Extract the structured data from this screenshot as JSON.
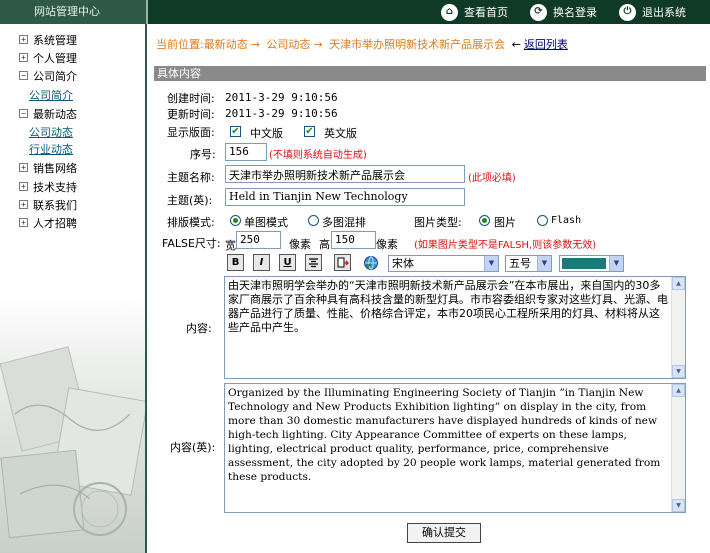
{
  "header": {
    "logo": "网站管理中心",
    "links": [
      {
        "label": "查看首页",
        "icon": "home-icon"
      },
      {
        "label": "换名登录",
        "icon": "switch-user-icon"
      },
      {
        "label": "退出系统",
        "icon": "logout-icon"
      }
    ]
  },
  "sidebar": {
    "items": [
      {
        "label": "系统管理",
        "toggle": "+"
      },
      {
        "label": "个人管理",
        "toggle": "+"
      },
      {
        "label": "公司简介",
        "toggle": "−"
      },
      {
        "label": "最新动态",
        "toggle": "−"
      },
      {
        "label": "销售网络",
        "toggle": "+"
      },
      {
        "label": "技术支持",
        "toggle": "+"
      },
      {
        "label": "联系我们",
        "toggle": "+"
      },
      {
        "label": "人才招聘",
        "toggle": "+"
      }
    ],
    "subitems": {
      "company_intro": "公司简介",
      "company_news": "公司动态",
      "industry_news": "行业动态"
    }
  },
  "breadcrumb": {
    "prefix": "当前位置:最新动态",
    "arrow": "→",
    "level2": "公司动态",
    "level3": "天津市举办照明新技术新产品展示会",
    "back_arrow": "←",
    "back_label": "返回列表"
  },
  "section_title": "具体内容",
  "form": {
    "created_label": "创建时间:",
    "created_value": "2011-3-29 9:10:56",
    "updated_label": "更新时间:",
    "updated_value": "2011-3-29 9:10:56",
    "display_label": "显示版面:",
    "chinese_label": "中文版",
    "english_label": "英文版",
    "seq_label": "序号:",
    "seq_value": "156",
    "seq_hint": "(不填则系统自动生成)",
    "title_label": "主题名称:",
    "title_value": "天津市举办照明新技术新产品展示会",
    "title_hint": "(此项必填)",
    "title_en_label": "主题(英):",
    "title_en_value": "Held in Tianjin New Technology",
    "layout_label": "排版模式:",
    "layout_single": "单图模式",
    "layout_multi": "多图混排",
    "pic_type_label": "图片类型:",
    "pic_type_image": "图片",
    "pic_type_flash": "Flash",
    "size_label": "FALSE尺寸:",
    "width_label": "宽",
    "width_value": "250",
    "px_label": "像素",
    "height_label": "高",
    "height_value": "150",
    "px_label2": "像素",
    "size_hint": "(如果图片类型不是FALSH,则该参数无效)",
    "font_select": "宋体",
    "size_select": "五号",
    "color_value": "#1a7a7a",
    "content_label": "内容:",
    "content_value": "由天津市照明学会举办的“天津市照明新技术新产品展示会”在本市展出，来自国内的30多家厂商展示了百余种具有高科技含量的新型灯具。市市容委组织专家对这些灯具、光源、电器产品进行了质量、性能、价格综合评定，本市20项民心工程所采用的灯具、材料将从这些产品中产生。",
    "content_en_label": "内容(英):",
    "content_en_value": "Organized by the Illuminating Engineering Society of Tianjin ”in Tianjin New Technology and New Products Exhibition lighting” on display in the city, from more than 30 domestic manufacturers have displayed hundreds of kinds of new high-tech lighting. City Appearance Committee of experts on these lamps, lighting, electrical product quality, performance, price, comprehensive assessment, the city adopted by 20 people work lamps, material generated from these products.",
    "submit_label": "确认提交"
  },
  "toolbar": {
    "bold": "B",
    "italic": "I",
    "underline": "U"
  }
}
